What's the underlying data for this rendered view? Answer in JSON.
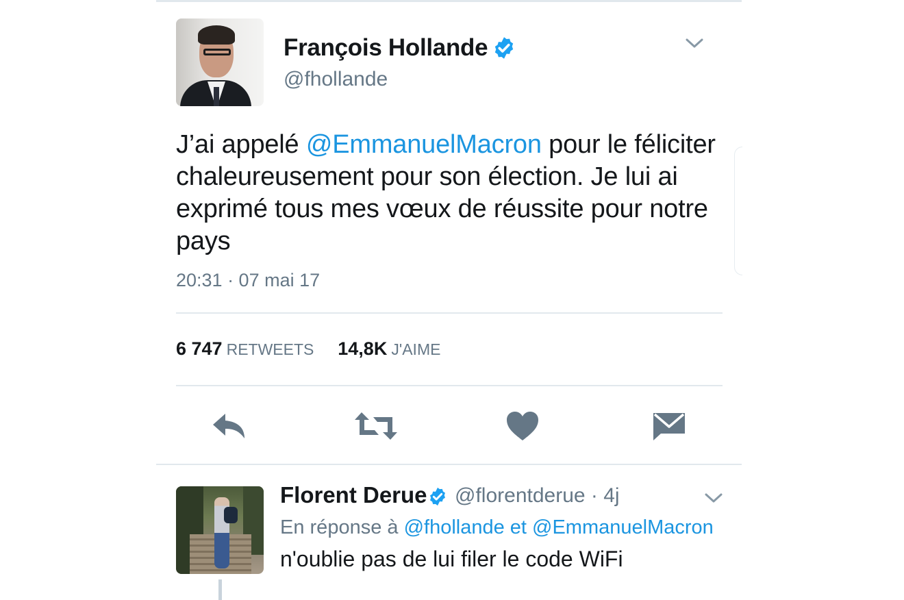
{
  "tweet": {
    "author": {
      "name": "François Hollande",
      "handle": "@fhollande",
      "verified": true,
      "avatar_icon": "avatar-photo"
    },
    "text": {
      "part1": "J’ai appelé ",
      "mention": "@EmmanuelMacron",
      "part2": " pour le féliciter chaleureusement pour son élection. Je lui ai exprimé tous mes vœux de réussite pour notre pays"
    },
    "timestamp": "20:31 · 07 mai 17",
    "stats": {
      "retweets_count": "6 747",
      "retweets_label": "RETWEETS",
      "likes_count": "14,8K",
      "likes_label": "J'AIME"
    },
    "actions": [
      "reply-icon",
      "retweet-icon",
      "heart-icon",
      "envelope-icon"
    ]
  },
  "reply": {
    "author": {
      "name": "Florent Derue",
      "handle": "@florentderue · 4j",
      "verified": true
    },
    "context": {
      "prefix": "En réponse à ",
      "mentions": "@fhollande et @EmmanuelMacron"
    },
    "text": "n'oublie pas de lui filer le code WiFi"
  },
  "colors": {
    "accent": "#1b95e0",
    "verified": "#1da1f2",
    "secondary_text": "#657786",
    "icon": "#657786"
  }
}
